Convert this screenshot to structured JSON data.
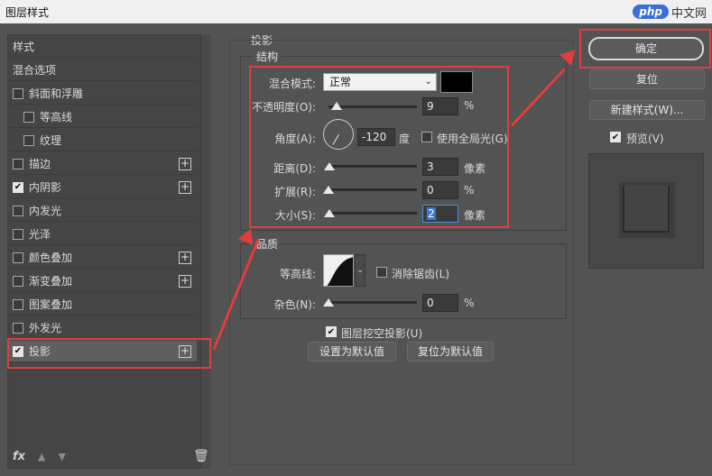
{
  "title": "图层样式",
  "logo": {
    "brand": "php",
    "suffix": "中文网"
  },
  "styles_list": {
    "items": [
      {
        "label": "样式",
        "checkbox": false,
        "plus": false
      },
      {
        "label": "混合选项",
        "checkbox": false,
        "plus": false
      },
      {
        "label": "斜面和浮雕",
        "checkbox": true,
        "checked": false,
        "plus": false
      },
      {
        "label": "等高线",
        "checkbox": true,
        "checked": false,
        "plus": false,
        "indent": true
      },
      {
        "label": "纹理",
        "checkbox": true,
        "checked": false,
        "plus": false,
        "indent": true
      },
      {
        "label": "描边",
        "checkbox": true,
        "checked": false,
        "plus": true
      },
      {
        "label": "内阴影",
        "checkbox": true,
        "checked": true,
        "plus": true
      },
      {
        "label": "内发光",
        "checkbox": true,
        "checked": false,
        "plus": false
      },
      {
        "label": "光泽",
        "checkbox": true,
        "checked": false,
        "plus": false
      },
      {
        "label": "颜色叠加",
        "checkbox": true,
        "checked": false,
        "plus": true
      },
      {
        "label": "渐变叠加",
        "checkbox": true,
        "checked": false,
        "plus": true
      },
      {
        "label": "图案叠加",
        "checkbox": true,
        "checked": false,
        "plus": false
      },
      {
        "label": "外发光",
        "checkbox": true,
        "checked": false,
        "plus": false
      },
      {
        "label": "投影",
        "checkbox": true,
        "checked": true,
        "plus": true,
        "selected": true
      }
    ],
    "fx_label": "fx"
  },
  "drop_shadow": {
    "section_title": "投影",
    "structure": {
      "title": "结构",
      "blend_mode_label": "混合模式:",
      "blend_mode_value": "正常",
      "shadow_color": "#000000",
      "opacity_label": "不透明度(O):",
      "opacity_value": "9",
      "opacity_unit": "%",
      "opacity_fraction": 0.09,
      "angle_label": "角度(A):",
      "angle_value": "-120",
      "angle_unit": "度",
      "global_light_label": "使用全局光(G)",
      "global_light_checked": false,
      "distance_label": "距离(D):",
      "distance_value": "3",
      "distance_unit": "像素",
      "spread_label": "扩展(R):",
      "spread_value": "0",
      "spread_unit": "%",
      "size_label": "大小(S):",
      "size_value": "2",
      "size_unit": "像素"
    },
    "quality": {
      "title": "品质",
      "contour_label": "等高线:",
      "antialias_label": "消除锯齿(L)",
      "antialias_checked": false,
      "noise_label": "杂色(N):",
      "noise_value": "0",
      "noise_unit": "%"
    },
    "knockout_label": "图层挖空投影(U)",
    "knockout_checked": true,
    "set_default_label": "设置为默认值",
    "reset_default_label": "复位为默认值"
  },
  "buttons": {
    "ok": "确定",
    "reset": "复位",
    "new_style": "新建样式(W)...",
    "preview_label": "预览(V)",
    "preview_checked": true
  },
  "colors": {
    "annotation": "#e13d3d",
    "panel": "#535353"
  }
}
